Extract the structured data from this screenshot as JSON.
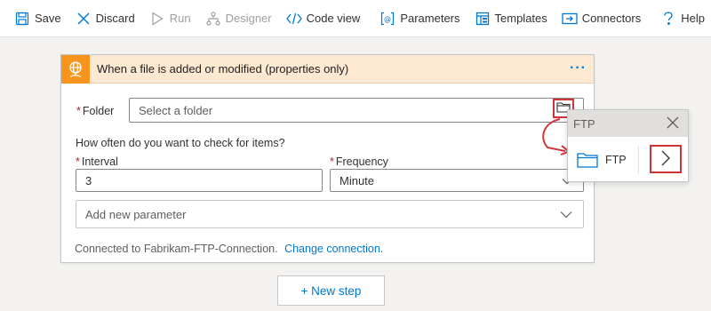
{
  "toolbar": {
    "save": "Save",
    "discard": "Discard",
    "run": "Run",
    "designer": "Designer",
    "code_view": "Code view",
    "parameters": "Parameters",
    "templates": "Templates",
    "connectors": "Connectors",
    "help": "Help"
  },
  "card": {
    "title": "When a file is added or modified (properties only)",
    "more": "···",
    "folder_label": "Folder",
    "folder_placeholder": "Select a folder",
    "check_prompt": "How often do you want to check for items?",
    "interval_label": "Interval",
    "interval_value": "3",
    "frequency_label": "Frequency",
    "frequency_value": "Minute",
    "add_param_placeholder": "Add new parameter",
    "connected_text": "Connected to Fabrikam-FTP-Connection.",
    "change_connection": "Change connection.",
    "required_mark": "*"
  },
  "popup": {
    "title": "FTP",
    "item_label": "FTP"
  },
  "new_step": "+ New step",
  "colors": {
    "accent": "#0078d4",
    "header_bg": "#fde8d2",
    "trigger_icon_bg": "#f7941d",
    "highlight_red": "#d13438"
  }
}
